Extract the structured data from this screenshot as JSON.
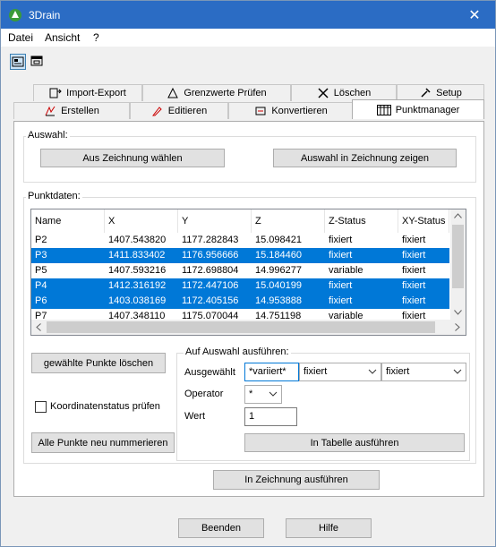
{
  "window": {
    "title": "3Drain",
    "close_glyph": "✕"
  },
  "menu": {
    "items": [
      "Datei",
      "Ansicht",
      "?"
    ]
  },
  "toolbar": {
    "buttons": [
      "view-layout-icon",
      "window-icon"
    ]
  },
  "tabs": {
    "row1": [
      "Import-Export",
      "Grenzwerte Prüfen",
      "Löschen",
      "Setup"
    ],
    "row2": [
      "Erstellen",
      "Editieren",
      "Konvertieren",
      "Punktmanager"
    ],
    "selected": "Punktmanager"
  },
  "auswahl": {
    "label": "Auswahl:",
    "btn_from_drawing": "Aus Zeichnung wählen",
    "btn_show_in_drawing": "Auswahl in Zeichnung zeigen"
  },
  "punktdaten": {
    "label": "Punktdaten:",
    "columns": [
      "Name",
      "X",
      "Y",
      "Z",
      "Z-Status",
      "XY-Status"
    ],
    "rows": [
      {
        "name": "P2",
        "x": "1407.543820",
        "y": "1177.282843",
        "z": "15.098421",
        "zs": "fixiert",
        "xys": "fixiert",
        "selected": false
      },
      {
        "name": "P3",
        "x": "1411.833402",
        "y": "1176.956666",
        "z": "15.184460",
        "zs": "fixiert",
        "xys": "fixiert",
        "selected": true
      },
      {
        "name": "P5",
        "x": "1407.593216",
        "y": "1172.698804",
        "z": "14.996277",
        "zs": "variable",
        "xys": "fixiert",
        "selected": false
      },
      {
        "name": "P4",
        "x": "1412.316192",
        "y": "1172.447106",
        "z": "15.040199",
        "zs": "fixiert",
        "xys": "fixiert",
        "selected": true
      },
      {
        "name": "P6",
        "x": "1403.038169",
        "y": "1172.405156",
        "z": "14.953888",
        "zs": "fixiert",
        "xys": "fixiert",
        "selected": true
      },
      {
        "name": "P7",
        "x": "1407.348110",
        "y": "1175.070044",
        "z": "14.751198",
        "zs": "variable",
        "xys": "fixiert",
        "selected": false
      }
    ]
  },
  "actions": {
    "delete_selected": "gewählte Punkte löschen",
    "check_coord_status": "Koordinatenstatus prüfen",
    "renumber_all": "Alle Punkte neu nummerieren"
  },
  "auf_auswahl": {
    "label": "Auf Auswahl ausführen:",
    "ausgewaehlt_label": "Ausgewählt",
    "ausgewaehlt_value": "*variiert*",
    "combo1": "fixiert",
    "combo2": "fixiert",
    "operator_label": "Operator",
    "operator_value": "*",
    "wert_label": "Wert",
    "wert_value": "1",
    "run_in_table": "In Tabelle ausführen"
  },
  "run_in_drawing": "In Zeichnung ausführen",
  "footer": {
    "beenden": "Beenden",
    "hilfe": "Hilfe"
  },
  "colors": {
    "selection": "#0078d7",
    "titlebar": "#2b6cc4"
  }
}
